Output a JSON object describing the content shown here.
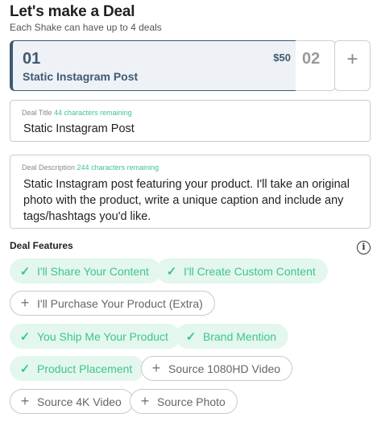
{
  "header": {
    "title": "Let's make a Deal",
    "subtitle": "Each Shake can have up to 4 deals"
  },
  "deal_tabs": {
    "active": {
      "number": "01",
      "price": "$50",
      "name": "Static Instagram Post"
    },
    "next": {
      "number": "02"
    },
    "add_label": "+"
  },
  "deal_title": {
    "label": "Deal Title",
    "remaining": "44 characters remaining",
    "value": "Static Instagram Post"
  },
  "deal_description": {
    "label": "Deal Description",
    "remaining": "244 characters remaining",
    "value": "Static Instagram post featuring your product. I'll take an original photo with the product, write a unique caption and include any tags/hashtags you'd like."
  },
  "features": {
    "heading": "Deal Features",
    "info_icon": "info-icon",
    "selected_color": "#3fc48c",
    "items": [
      {
        "label": "I'll Share Your Content",
        "selected": true,
        "icon": "✓"
      },
      {
        "label": "I'll Create Custom Content",
        "selected": true,
        "icon": "✓"
      },
      {
        "label": "I'll Purchase Your Product (Extra)",
        "selected": false,
        "icon": "+"
      },
      {
        "label": "You Ship Me Your Product",
        "selected": true,
        "icon": "✓"
      },
      {
        "label": "Brand Mention",
        "selected": true,
        "icon": "✓"
      },
      {
        "label": "Product Placement",
        "selected": true,
        "icon": "✓"
      },
      {
        "label": "Source 1080HD Video",
        "selected": false,
        "icon": "+"
      },
      {
        "label": "Source 4K Video",
        "selected": false,
        "icon": "+"
      },
      {
        "label": "Source Photo",
        "selected": false,
        "icon": "+"
      }
    ]
  }
}
